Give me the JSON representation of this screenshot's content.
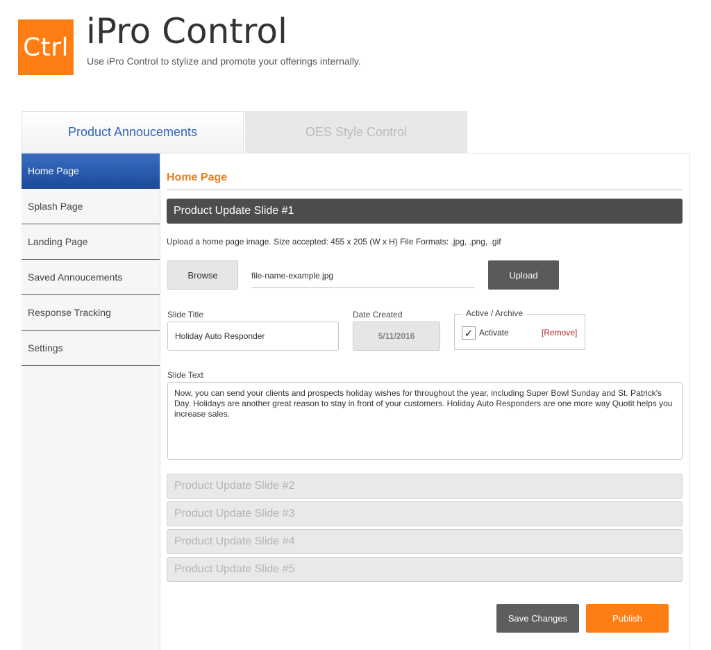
{
  "header": {
    "logo_text": "Ctrl",
    "title": "iPro Control",
    "subtitle": "Use iPro Control to stylize and promote your offerings internally."
  },
  "tabs": [
    {
      "label": "Product Annoucements",
      "active": true
    },
    {
      "label": "OES Style Control",
      "active": false
    }
  ],
  "sidebar": {
    "items": [
      {
        "label": "Home Page",
        "active": true
      },
      {
        "label": "Splash Page"
      },
      {
        "label": "Landing Page"
      },
      {
        "label": "Saved Annoucements"
      },
      {
        "label": "Response Tracking"
      },
      {
        "label": "Settings"
      }
    ]
  },
  "main": {
    "section_title": "Home Page",
    "open_slide": {
      "title": "Product Update Slide #1",
      "upload_note": "Upload a home page image.  Size accepted: 455 x 205 (W x H)  File Formats: .jpg, .png, .gif",
      "browse_label": "Browse",
      "file_name": "file-name-example.jpg",
      "upload_label": "Upload",
      "slide_title_label": "Slide Title",
      "slide_title_value": "Holiday Auto Responder",
      "date_created_label": "Date Created",
      "date_created_value": "5/11/2016",
      "active_archive_label": "Active / Archive",
      "activate_label": "Activate",
      "activate_checked": true,
      "remove_label": "[Remove]",
      "slide_text_label": "Slide Text",
      "slide_text_value": "Now, you can send your clients and prospects holiday wishes for throughout the year, including Super Bowl Sunday and St. Patrick's Day. Holidays are another great reason to stay in front of your customers. Holiday Auto Responders are one more way Quotit helps you increase sales."
    },
    "collapsed_slides": [
      "Product Update Slide #2",
      "Product Update Slide #3",
      "Product Update Slide #4",
      "Product Update Slide #5"
    ],
    "save_label": "Save Changes",
    "publish_label": "Publish"
  },
  "colors": {
    "accent_orange": "#ff7e14",
    "active_blue": "#2e63b8",
    "dark_bar": "#4d4d4d"
  }
}
